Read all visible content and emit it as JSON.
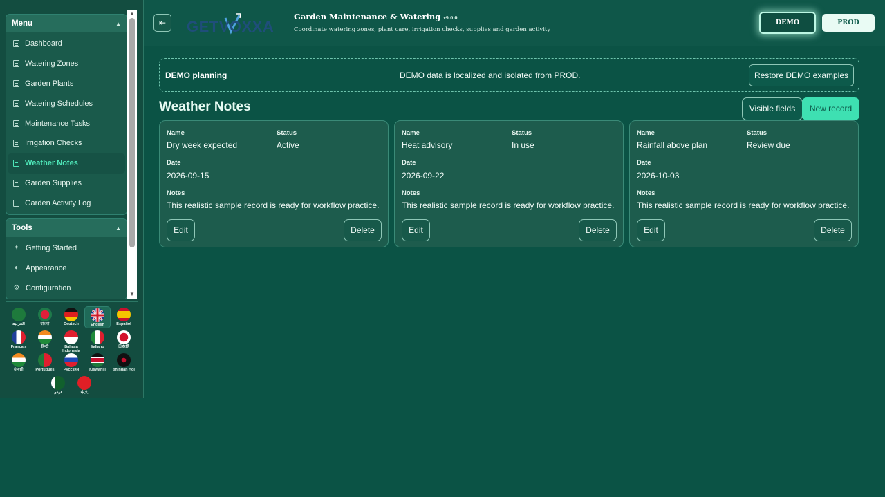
{
  "sidebar": {
    "menu": {
      "title": "Menu",
      "items": [
        {
          "label": "Dashboard"
        },
        {
          "label": "Watering Zones"
        },
        {
          "label": "Garden Plants"
        },
        {
          "label": "Watering Schedules"
        },
        {
          "label": "Maintenance Tasks"
        },
        {
          "label": "Irrigation Checks"
        },
        {
          "label": "Weather Notes",
          "active": true
        },
        {
          "label": "Garden Supplies"
        },
        {
          "label": "Garden Activity Log"
        }
      ]
    },
    "tools": {
      "title": "Tools",
      "items": [
        {
          "label": "Getting Started",
          "icon": "sparkle-icon"
        },
        {
          "label": "Appearance",
          "icon": "palette-icon"
        },
        {
          "label": "Configuration",
          "icon": "gear-icon"
        }
      ]
    },
    "languages": [
      {
        "name": "العربية",
        "icon": "flag-saudi-arabia"
      },
      {
        "name": "বাংলা",
        "icon": "flag-bangladesh"
      },
      {
        "name": "Deutsch",
        "icon": "flag-germany"
      },
      {
        "name": "English",
        "icon": "flag-uk",
        "selected": true
      },
      {
        "name": "Español",
        "icon": "flag-spain"
      },
      {
        "name": "Français",
        "icon": "flag-france"
      },
      {
        "name": "हिन्दी",
        "icon": "flag-india"
      },
      {
        "name": "Bahasa Indonesia",
        "icon": "flag-indonesia"
      },
      {
        "name": "Italiano",
        "icon": "flag-italy"
      },
      {
        "name": "日本語",
        "icon": "flag-japan"
      },
      {
        "name": "ਪੰਜਾਬੀ",
        "icon": "flag-india"
      },
      {
        "name": "Português",
        "icon": "flag-portugal"
      },
      {
        "name": "Русский",
        "icon": "flag-russia"
      },
      {
        "name": "Kiswahili",
        "icon": "flag-kenya"
      },
      {
        "name": "tlhIngan Hol",
        "icon": "flag-klingon"
      },
      {
        "name": "اردو",
        "icon": "flag-pakistan"
      },
      {
        "name": "中文",
        "icon": "flag-china"
      }
    ]
  },
  "header": {
    "logo_text": "GETVOXXA",
    "title": "Garden Maintenance & Watering",
    "version": "v9.0.0",
    "subtitle": "Coordinate watering zones, plant care, irrigation checks, supplies and garden activity",
    "env_demo": "DEMO",
    "env_prod": "PROD"
  },
  "banner": {
    "title": "DEMO planning",
    "message": "DEMO data is localized and isolated from PROD.",
    "restore_label": "Restore DEMO examples"
  },
  "section": {
    "title": "Weather Notes",
    "visible_fields_label": "Visible fields",
    "new_record_label": "New record"
  },
  "field_labels": {
    "name": "Name",
    "status": "Status",
    "date": "Date",
    "notes": "Notes"
  },
  "records": [
    {
      "name": "Dry week expected",
      "status": "Active",
      "date": "2026-09-15",
      "notes": "This realistic sample record is ready for workflow practice.",
      "edit": "Edit",
      "delete": "Delete"
    },
    {
      "name": "Heat advisory",
      "status": "In use",
      "date": "2026-09-22",
      "notes": "This realistic sample record is ready for workflow practice.",
      "edit": "Edit",
      "delete": "Delete"
    },
    {
      "name": "Rainfall above plan",
      "status": "Review due",
      "date": "2026-10-03",
      "notes": "This realistic sample record is ready for workflow practice.",
      "edit": "Edit",
      "delete": "Delete"
    }
  ],
  "colors": {
    "background": "#0b5345",
    "accent": "#3ee0b2",
    "active_nav": "#4ee6b8",
    "card": "#1d5c4d"
  }
}
